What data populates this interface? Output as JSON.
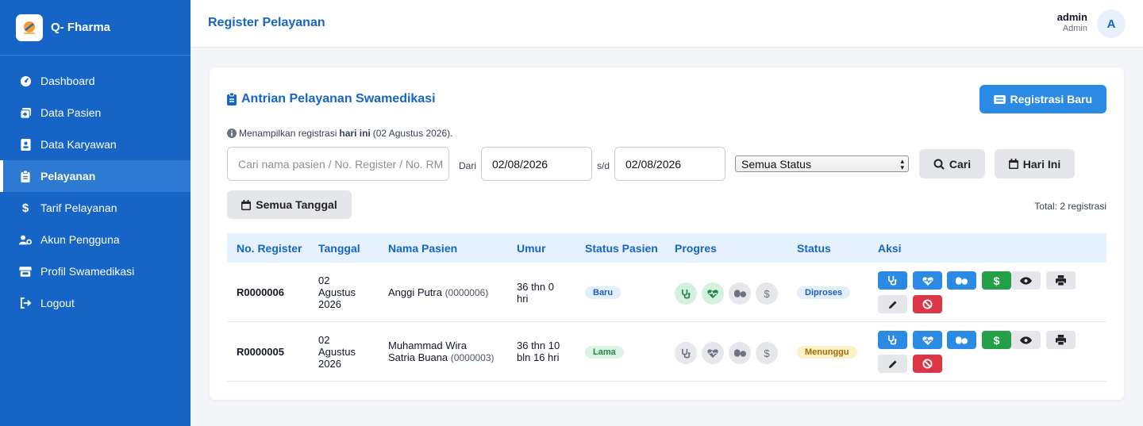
{
  "app": {
    "name": "Q- Fharma"
  },
  "sidebar": {
    "items": [
      {
        "label": "Dashboard",
        "icon": "dashboard-icon"
      },
      {
        "label": "Data Pasien",
        "icon": "patient-data-icon"
      },
      {
        "label": "Data Karyawan",
        "icon": "employee-id-icon"
      },
      {
        "label": "Pelayanan",
        "icon": "clipboard-icon",
        "active": true
      },
      {
        "label": "Tarif Pelayanan",
        "icon": "dollar-icon"
      },
      {
        "label": "Akun Pengguna",
        "icon": "user-gear-icon"
      },
      {
        "label": "Profil Swamedikasi",
        "icon": "store-icon"
      },
      {
        "label": "Logout",
        "icon": "logout-icon"
      }
    ]
  },
  "header": {
    "title": "Register Pelayanan",
    "user_name": "admin",
    "user_role": "Admin",
    "avatar_letter": "A"
  },
  "card": {
    "title": "Antrian Pelayanan Swamedikasi",
    "new_button": "Registrasi Baru",
    "info_prefix": "Menampilkan registrasi",
    "info_bold": "hari ini",
    "info_suffix": "(02 Agustus 2026).",
    "search_placeholder": "Cari nama pasien / No. Register / No. RM",
    "from_label": "Dari",
    "from_date": "02/08/2026",
    "to_label": "s/d",
    "to_date": "02/08/2026",
    "status_select": "Semua Status",
    "search_button": "Cari",
    "today_button": "Hari Ini",
    "all_dates_button": "Semua Tanggal",
    "total": "Total: 2 registrasi"
  },
  "table": {
    "headers": [
      "No. Register",
      "Tanggal",
      "Nama Pasien",
      "Umur",
      "Status Pasien",
      "Progres",
      "Status",
      "Aksi"
    ],
    "rows": [
      {
        "register": "R0000006",
        "date_l1": "02",
        "date_l2": "Agustus",
        "date_l3": "2026",
        "name_l1": "Anggi Putra",
        "name_l2": "",
        "rm": "(0000006)",
        "age_l1": "36 thn 0",
        "age_l2": "hri",
        "patient_status": "Baru",
        "progress_done": [
          true,
          true,
          false,
          false
        ],
        "status": "Diproses"
      },
      {
        "register": "R0000005",
        "date_l1": "02",
        "date_l2": "Agustus",
        "date_l3": "2026",
        "name_l1": "Muhammad Wira",
        "name_l2": "Satria Buana",
        "rm": "(0000003)",
        "age_l1": "36 thn 10",
        "age_l2": "bln 16 hri",
        "patient_status": "Lama",
        "progress_done": [
          false,
          false,
          false,
          false
        ],
        "status": "Menunggu"
      }
    ]
  },
  "colors": {
    "sidebar": "#1665c6",
    "accent": "#2b8ae4",
    "success": "#23a048",
    "danger": "#dc3545"
  }
}
